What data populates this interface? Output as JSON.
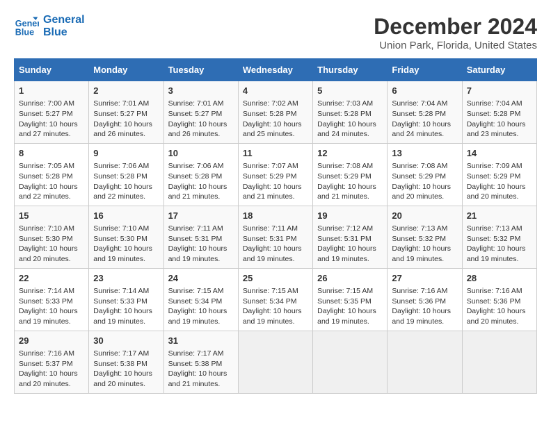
{
  "logo": {
    "line1": "General",
    "line2": "Blue"
  },
  "title": "December 2024",
  "subtitle": "Union Park, Florida, United States",
  "weekdays": [
    "Sunday",
    "Monday",
    "Tuesday",
    "Wednesday",
    "Thursday",
    "Friday",
    "Saturday"
  ],
  "weeks": [
    [
      {
        "day": "1",
        "info": "Sunrise: 7:00 AM\nSunset: 5:27 PM\nDaylight: 10 hours\nand 27 minutes."
      },
      {
        "day": "2",
        "info": "Sunrise: 7:01 AM\nSunset: 5:27 PM\nDaylight: 10 hours\nand 26 minutes."
      },
      {
        "day": "3",
        "info": "Sunrise: 7:01 AM\nSunset: 5:27 PM\nDaylight: 10 hours\nand 26 minutes."
      },
      {
        "day": "4",
        "info": "Sunrise: 7:02 AM\nSunset: 5:28 PM\nDaylight: 10 hours\nand 25 minutes."
      },
      {
        "day": "5",
        "info": "Sunrise: 7:03 AM\nSunset: 5:28 PM\nDaylight: 10 hours\nand 24 minutes."
      },
      {
        "day": "6",
        "info": "Sunrise: 7:04 AM\nSunset: 5:28 PM\nDaylight: 10 hours\nand 24 minutes."
      },
      {
        "day": "7",
        "info": "Sunrise: 7:04 AM\nSunset: 5:28 PM\nDaylight: 10 hours\nand 23 minutes."
      }
    ],
    [
      {
        "day": "8",
        "info": "Sunrise: 7:05 AM\nSunset: 5:28 PM\nDaylight: 10 hours\nand 22 minutes."
      },
      {
        "day": "9",
        "info": "Sunrise: 7:06 AM\nSunset: 5:28 PM\nDaylight: 10 hours\nand 22 minutes."
      },
      {
        "day": "10",
        "info": "Sunrise: 7:06 AM\nSunset: 5:28 PM\nDaylight: 10 hours\nand 21 minutes."
      },
      {
        "day": "11",
        "info": "Sunrise: 7:07 AM\nSunset: 5:29 PM\nDaylight: 10 hours\nand 21 minutes."
      },
      {
        "day": "12",
        "info": "Sunrise: 7:08 AM\nSunset: 5:29 PM\nDaylight: 10 hours\nand 21 minutes."
      },
      {
        "day": "13",
        "info": "Sunrise: 7:08 AM\nSunset: 5:29 PM\nDaylight: 10 hours\nand 20 minutes."
      },
      {
        "day": "14",
        "info": "Sunrise: 7:09 AM\nSunset: 5:29 PM\nDaylight: 10 hours\nand 20 minutes."
      }
    ],
    [
      {
        "day": "15",
        "info": "Sunrise: 7:10 AM\nSunset: 5:30 PM\nDaylight: 10 hours\nand 20 minutes."
      },
      {
        "day": "16",
        "info": "Sunrise: 7:10 AM\nSunset: 5:30 PM\nDaylight: 10 hours\nand 19 minutes."
      },
      {
        "day": "17",
        "info": "Sunrise: 7:11 AM\nSunset: 5:31 PM\nDaylight: 10 hours\nand 19 minutes."
      },
      {
        "day": "18",
        "info": "Sunrise: 7:11 AM\nSunset: 5:31 PM\nDaylight: 10 hours\nand 19 minutes."
      },
      {
        "day": "19",
        "info": "Sunrise: 7:12 AM\nSunset: 5:31 PM\nDaylight: 10 hours\nand 19 minutes."
      },
      {
        "day": "20",
        "info": "Sunrise: 7:13 AM\nSunset: 5:32 PM\nDaylight: 10 hours\nand 19 minutes."
      },
      {
        "day": "21",
        "info": "Sunrise: 7:13 AM\nSunset: 5:32 PM\nDaylight: 10 hours\nand 19 minutes."
      }
    ],
    [
      {
        "day": "22",
        "info": "Sunrise: 7:14 AM\nSunset: 5:33 PM\nDaylight: 10 hours\nand 19 minutes."
      },
      {
        "day": "23",
        "info": "Sunrise: 7:14 AM\nSunset: 5:33 PM\nDaylight: 10 hours\nand 19 minutes."
      },
      {
        "day": "24",
        "info": "Sunrise: 7:15 AM\nSunset: 5:34 PM\nDaylight: 10 hours\nand 19 minutes."
      },
      {
        "day": "25",
        "info": "Sunrise: 7:15 AM\nSunset: 5:34 PM\nDaylight: 10 hours\nand 19 minutes."
      },
      {
        "day": "26",
        "info": "Sunrise: 7:15 AM\nSunset: 5:35 PM\nDaylight: 10 hours\nand 19 minutes."
      },
      {
        "day": "27",
        "info": "Sunrise: 7:16 AM\nSunset: 5:36 PM\nDaylight: 10 hours\nand 19 minutes."
      },
      {
        "day": "28",
        "info": "Sunrise: 7:16 AM\nSunset: 5:36 PM\nDaylight: 10 hours\nand 20 minutes."
      }
    ],
    [
      {
        "day": "29",
        "info": "Sunrise: 7:16 AM\nSunset: 5:37 PM\nDaylight: 10 hours\nand 20 minutes."
      },
      {
        "day": "30",
        "info": "Sunrise: 7:17 AM\nSunset: 5:38 PM\nDaylight: 10 hours\nand 20 minutes."
      },
      {
        "day": "31",
        "info": "Sunrise: 7:17 AM\nSunset: 5:38 PM\nDaylight: 10 hours\nand 21 minutes."
      },
      {
        "day": "",
        "info": ""
      },
      {
        "day": "",
        "info": ""
      },
      {
        "day": "",
        "info": ""
      },
      {
        "day": "",
        "info": ""
      }
    ]
  ]
}
